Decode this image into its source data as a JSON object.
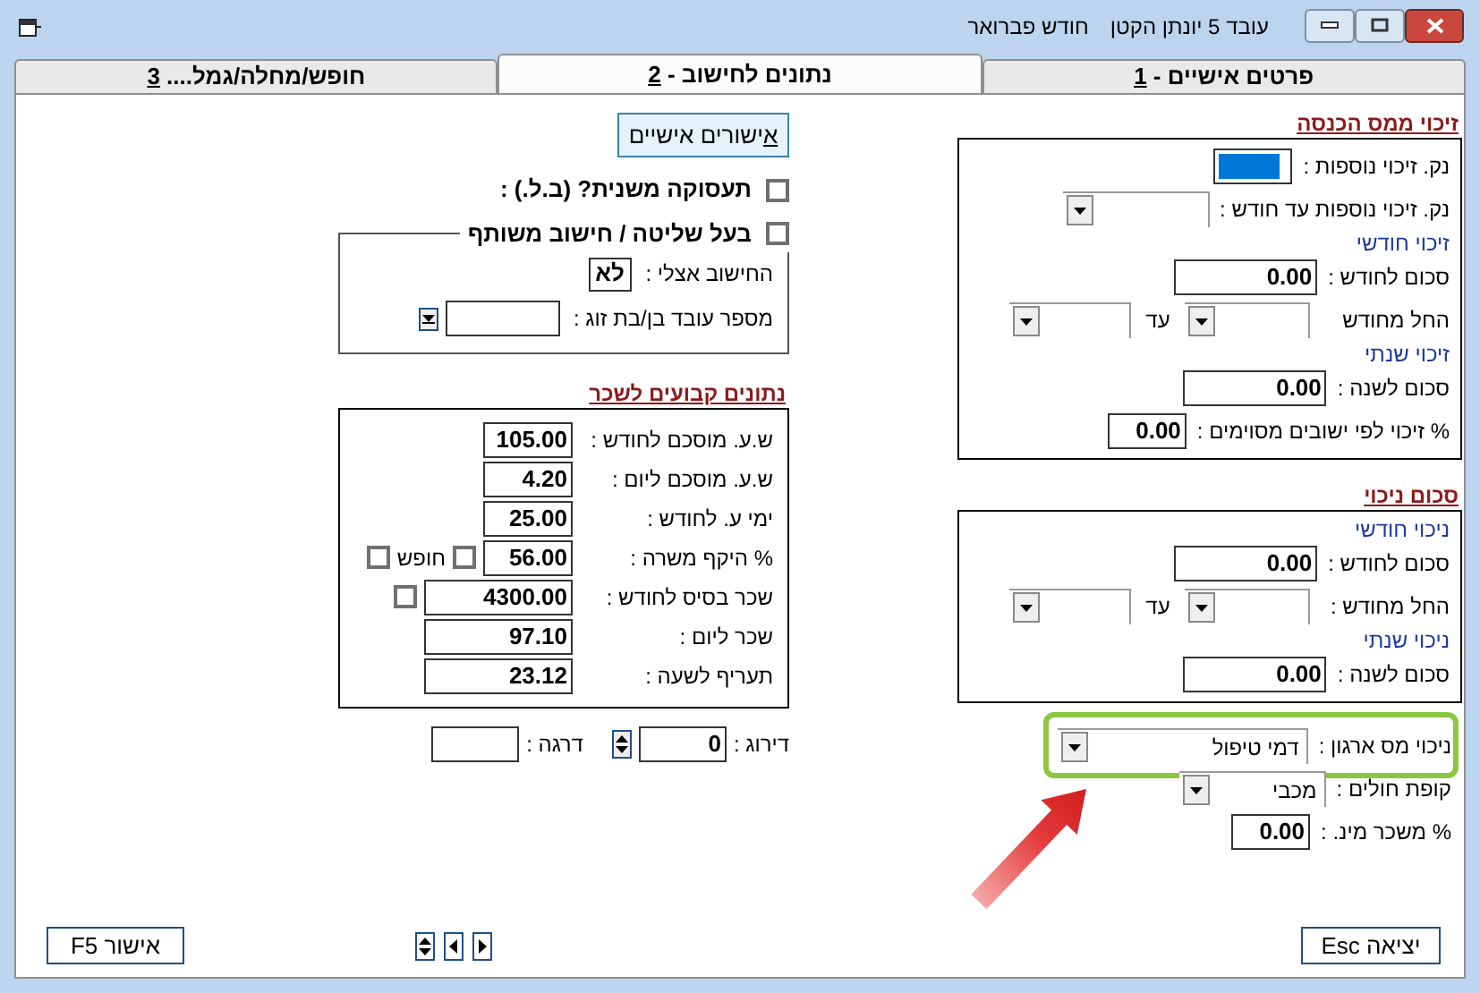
{
  "window": {
    "title_parts": [
      "עובד 5 יונתן הקטן",
      "חודש פברואר"
    ]
  },
  "tabs": [
    {
      "label": "פרטים אישיים - ",
      "hotkey": "1",
      "selected": false
    },
    {
      "label": "נתונים לחישוב - ",
      "hotkey": "2",
      "selected": true
    },
    {
      "label": "חופש/מחלה/גמל.... ",
      "hotkey": "3",
      "selected": false
    }
  ],
  "tax_credit": {
    "title": "זיכוי ממס הכנסה",
    "rows": [
      {
        "kind": "short_input",
        "label": "נק. זיכוי נוספות :",
        "focused": true
      },
      {
        "kind": "dropdown",
        "label": "נק. זיכוי נוספות עד חודש :"
      },
      {
        "kind": "heading",
        "text": "זיכוי חודשי"
      },
      {
        "kind": "input",
        "label": "סכום לחודש :",
        "value": "0.00"
      },
      {
        "kind": "range",
        "label": "החל מחודש",
        "to_label": "עד"
      },
      {
        "kind": "heading",
        "text": "זיכוי שנתי"
      },
      {
        "kind": "input",
        "label": "סכום לשנה :",
        "value": "0.00"
      },
      {
        "kind": "short_input",
        "label": "% זיכוי לפי ישובים מסוימים :",
        "value": "0.00"
      }
    ]
  },
  "deduction": {
    "title": "סכום ניכוי",
    "rows": [
      {
        "kind": "heading",
        "text": "ניכוי חודשי"
      },
      {
        "kind": "input",
        "label": "סכום לחודש :",
        "value": "0.00"
      },
      {
        "kind": "range",
        "label": "החל מחודש :",
        "to_label": "עד"
      },
      {
        "kind": "heading",
        "text": "ניכוי שנתי"
      },
      {
        "kind": "input",
        "label": "סכום לשנה :",
        "value": "0.00"
      }
    ]
  },
  "extra_rows": [
    {
      "kind": "dropdown_wide",
      "label": "ניכוי מס ארגון :",
      "value": "דמי טיפול",
      "highlighted": true
    },
    {
      "kind": "dropdown",
      "label": "קופת חולים :",
      "value": "מכבי"
    },
    {
      "kind": "short_input",
      "label": "% משכר מינ. :",
      "value": "0.00"
    }
  ],
  "approvals_button": {
    "hotkey": "א",
    "label": "ישורים אישיים"
  },
  "secondary_employment": {
    "label": "תעסוקה משנית? (ב.ל.) :",
    "checked": false
  },
  "controlling_owner": {
    "label": "בעל שליטה / חישוב משותף",
    "checked": false,
    "rows": [
      {
        "kind": "value_box",
        "label": "החישוב אצלי :",
        "value": "לא"
      },
      {
        "kind": "input_dropdown",
        "label": "מספר עובד בן/בת זוג :"
      }
    ]
  },
  "fixed_salary": {
    "title": "נתונים קבועים לשכר",
    "rows": [
      {
        "kind": "input",
        "label": "ש.ע. מוסכם לחודש :",
        "value": "105.00"
      },
      {
        "kind": "input",
        "label": "ש.ע. מוסכם ליום :",
        "value": "4.20"
      },
      {
        "kind": "input",
        "label": "ימי ע. לחודש :",
        "value": "25.00"
      },
      {
        "kind": "input",
        "label": "% היקף משרה   :",
        "value": "56.00",
        "extras": [
          {
            "kind": "checkbox",
            "checked": false
          },
          {
            "kind": "text",
            "text": "חופש"
          },
          {
            "kind": "checkbox",
            "checked": false
          }
        ]
      },
      {
        "kind": "wide_input",
        "label": "שכר בסיס לחודש :",
        "value": "4300.00",
        "extras": [
          {
            "kind": "checkbox",
            "checked": false
          }
        ]
      },
      {
        "kind": "wide_input",
        "label": "שכר ליום :",
        "value": "97.10"
      },
      {
        "kind": "wide_input",
        "label": "תעריף לשעה :",
        "value": "23.12"
      }
    ]
  },
  "grade_row": [
    {
      "kind": "spin_input",
      "label": "דירוג :",
      "value": "0"
    },
    {
      "kind": "input",
      "label": "דרגה :"
    }
  ],
  "buttons": {
    "exit": "יציאה Esc",
    "confirm": "אישור F5"
  }
}
